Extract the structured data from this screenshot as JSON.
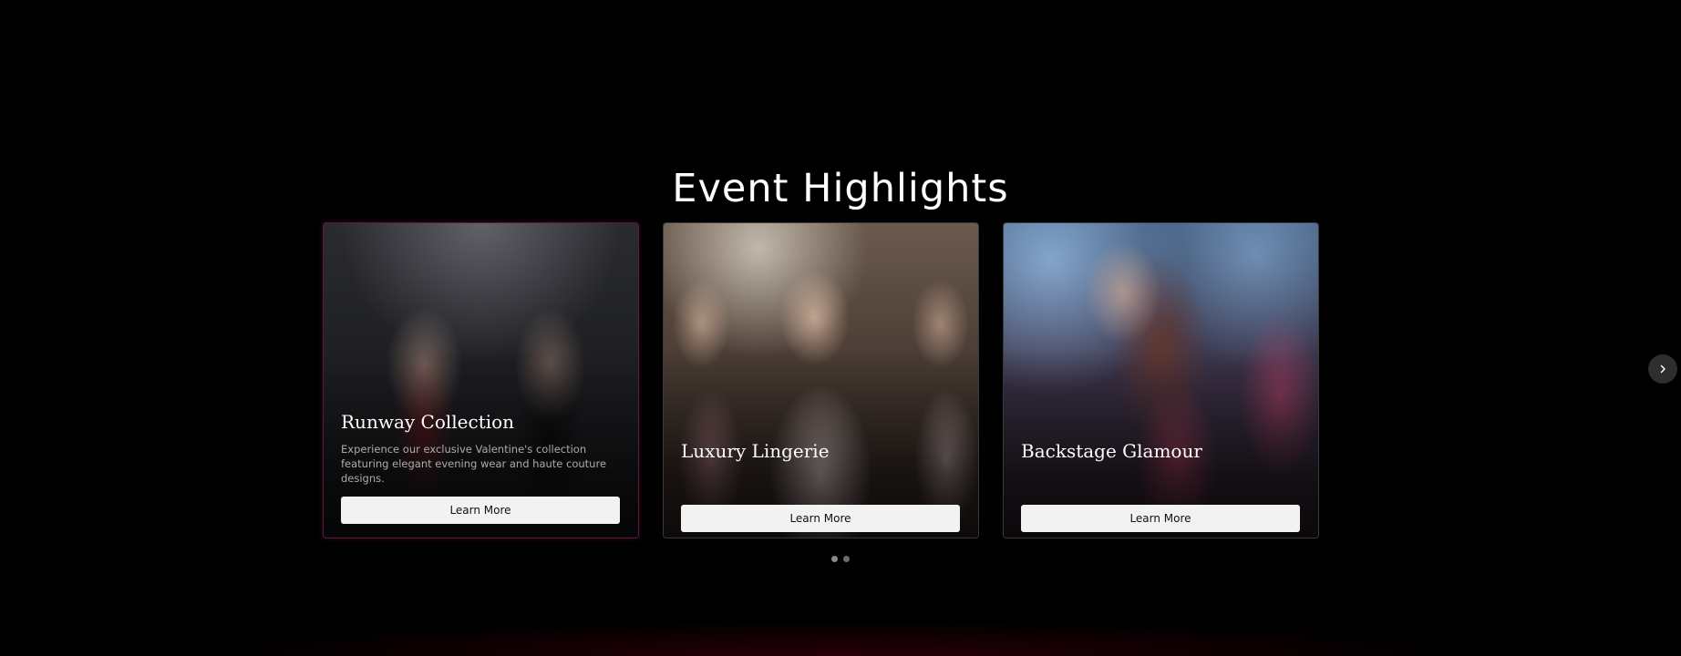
{
  "section": {
    "title": "Event Highlights"
  },
  "cards": [
    {
      "title": "Runway Collection",
      "description": "Experience our exclusive Valentine's collection featuring elegant evening wear and haute couture designs.",
      "button_label": "Learn More"
    },
    {
      "title": "Luxury Lingerie",
      "button_label": "Learn More"
    },
    {
      "title": "Backstage Glamour",
      "button_label": "Learn More"
    }
  ],
  "carousel": {
    "page_count": 2,
    "active_page": 1,
    "next_icon": "chevron-right-icon"
  },
  "colors": {
    "background": "#000000",
    "button_bg": "#f2f2f2",
    "active_card_border": "#5a1a40"
  }
}
